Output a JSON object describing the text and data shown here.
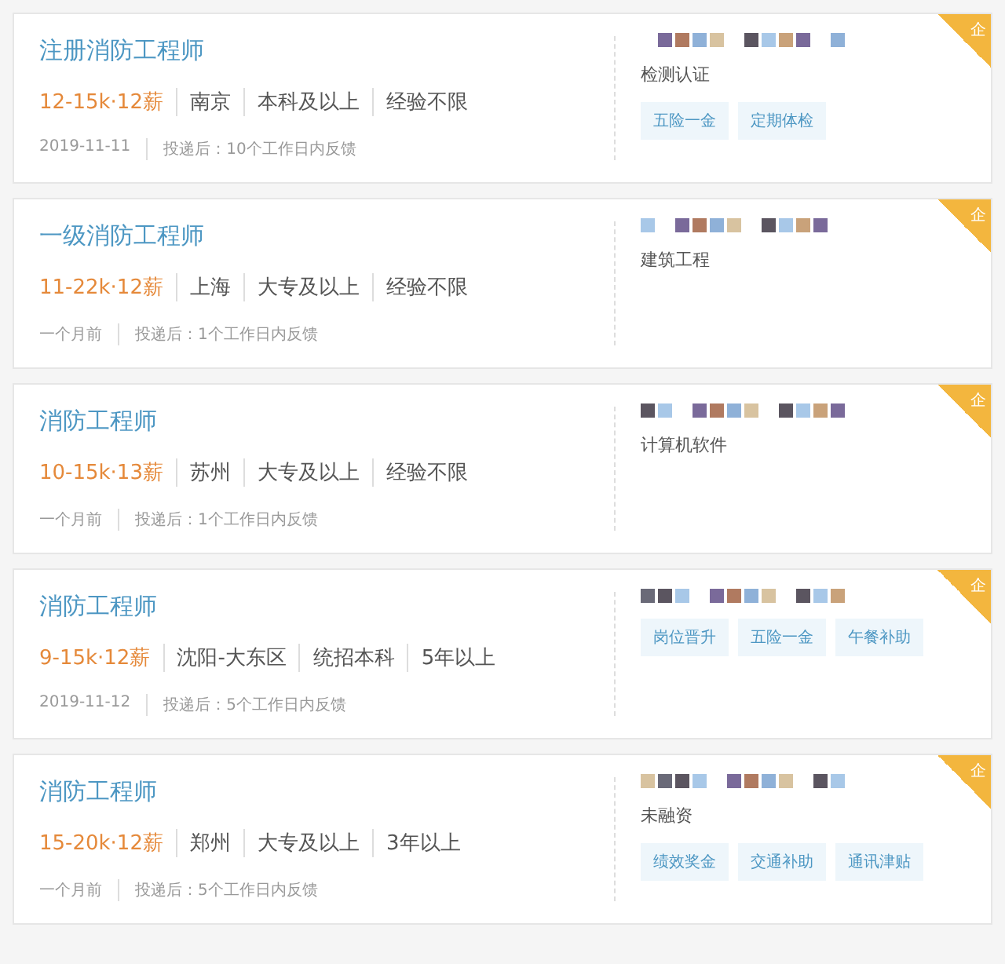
{
  "jobs": [
    {
      "title": "注册消防工程师",
      "salary": "12-15k·12薪",
      "requirements": [
        "南京",
        "本科及以上",
        "经验不限"
      ],
      "posted": "2019-11-11",
      "feedback": "投递后：10个工作日内反馈",
      "industry": "检测认证",
      "tags": [
        "五险一金",
        "定期体检"
      ],
      "badge": "企"
    },
    {
      "title": "一级消防工程师",
      "salary": "11-22k·12薪",
      "requirements": [
        "上海",
        "大专及以上",
        "经验不限"
      ],
      "posted": "一个月前",
      "feedback": "投递后：1个工作日内反馈",
      "industry": "建筑工程",
      "badge": "企"
    },
    {
      "title": "消防工程师",
      "salary": "10-15k·13薪",
      "requirements": [
        "苏州",
        "大专及以上",
        "经验不限"
      ],
      "posted": "一个月前",
      "feedback": "投递后：1个工作日内反馈",
      "industry": "计算机软件",
      "badge": "企"
    },
    {
      "title": "消防工程师",
      "salary": "9-15k·12薪",
      "requirements": [
        "沈阳-大东区",
        "统招本科",
        "5年以上"
      ],
      "posted": "2019-11-12",
      "feedback": "投递后：5个工作日内反馈",
      "tags": [
        "岗位晋升",
        "五险一金",
        "午餐补助"
      ],
      "badge": "企"
    },
    {
      "title": "消防工程师",
      "salary": "15-20k·12薪",
      "requirements": [
        "郑州",
        "大专及以上",
        "3年以上"
      ],
      "posted": "一个月前",
      "feedback": "投递后：5个工作日内反馈",
      "industry": "未融资",
      "tags": [
        "绩效奖金",
        "交通补助",
        "通讯津贴"
      ],
      "badge": "企"
    }
  ]
}
